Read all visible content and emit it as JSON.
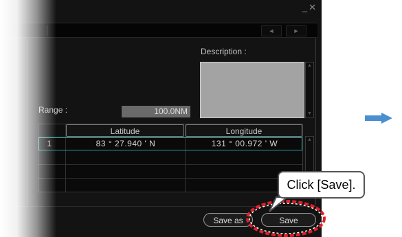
{
  "window": {
    "minimize_icon": "minimize-icon",
    "close_icon": "close-icon"
  },
  "toolbar": {
    "prev_icon": "◄",
    "next_icon": "►"
  },
  "description": {
    "label": "Description :",
    "value": ""
  },
  "range": {
    "label": "Range :",
    "value": "100.0NM"
  },
  "waypoints": {
    "columns": [
      "",
      "Latitude",
      "Longitude"
    ],
    "rows": [
      {
        "no": "1",
        "latitude": "83 ° 27.940 ' N",
        "longitude": "131 ° 00.972 ' W"
      },
      {
        "no": "",
        "latitude": "",
        "longitude": ""
      },
      {
        "no": "",
        "latitude": "",
        "longitude": ""
      },
      {
        "no": "",
        "latitude": "",
        "longitude": ""
      }
    ]
  },
  "buttons": {
    "save_as": "Save as",
    "save": "Save"
  },
  "annotation": {
    "callout": "Click [Save].",
    "highlight_color": "#e0202a",
    "arrow_color": "#4a8fd0"
  }
}
